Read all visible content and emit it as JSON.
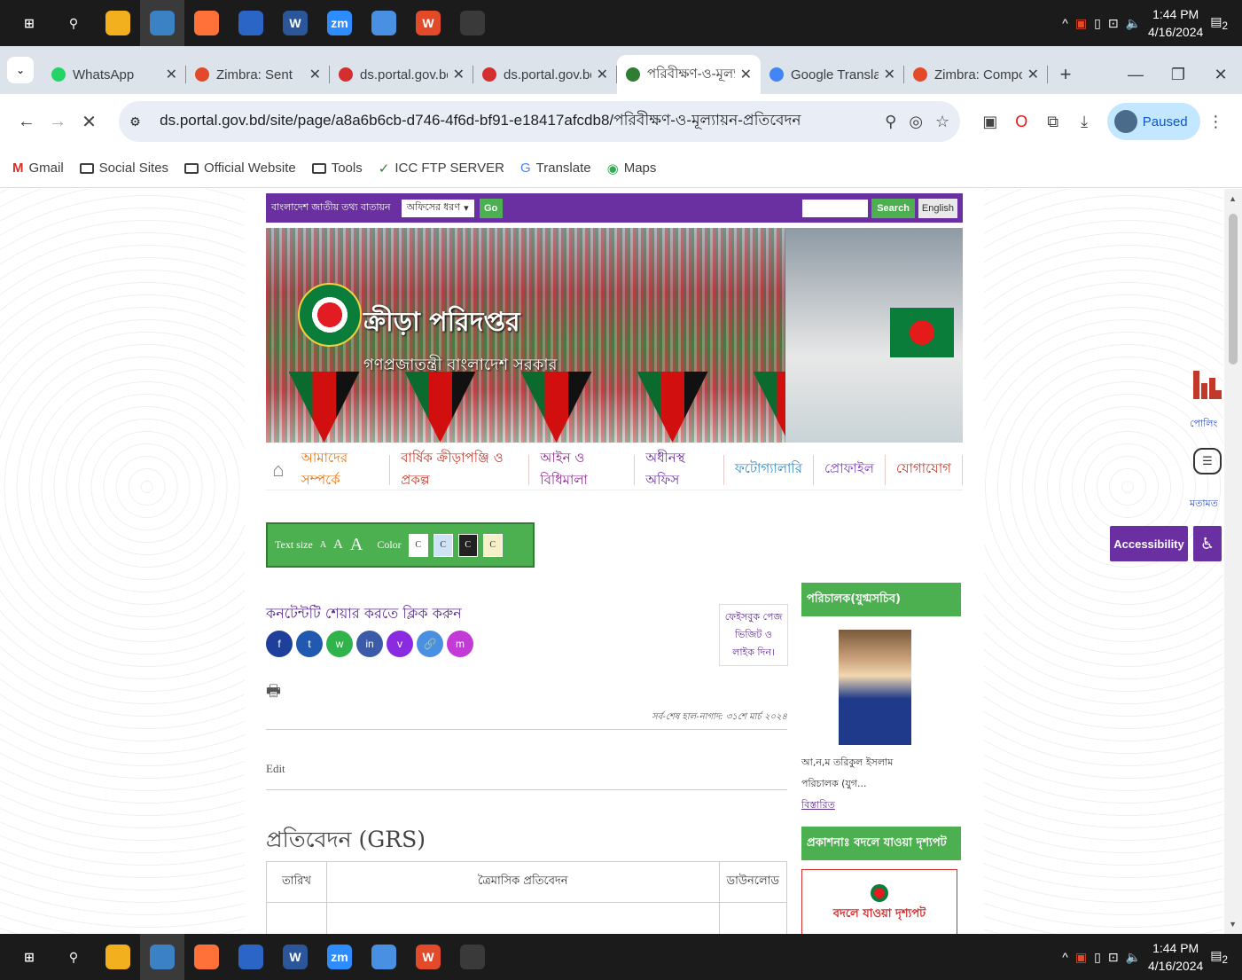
{
  "taskbar": {
    "apps": [
      {
        "name": "start",
        "glyph": "⊞",
        "color": "#1b1b1b"
      },
      {
        "name": "search",
        "glyph": "⚲",
        "color": "#1b1b1b"
      },
      {
        "name": "file-explorer",
        "glyph": "",
        "color": "#f2b01e"
      },
      {
        "name": "chrome",
        "glyph": "",
        "color": "#3b82c4"
      },
      {
        "name": "firefox",
        "glyph": "",
        "color": "#ff7139"
      },
      {
        "name": "mail",
        "glyph": "",
        "color": "#2b66c7"
      },
      {
        "name": "word",
        "glyph": "W",
        "color": "#2b579a"
      },
      {
        "name": "zoom",
        "glyph": "zm",
        "color": "#2d8cff"
      },
      {
        "name": "phone",
        "glyph": "",
        "color": "#4a90e2"
      },
      {
        "name": "wps",
        "glyph": "W",
        "color": "#e24a2a"
      },
      {
        "name": "app",
        "glyph": "",
        "color": "#3a3a3a"
      }
    ],
    "time": "1:44 PM",
    "date": "4/16/2024",
    "notif": "2"
  },
  "tabs": [
    {
      "title": "WhatsApp",
      "color": "#25d366",
      "active": false
    },
    {
      "title": "Zimbra: Sent",
      "color": "#e24a2a",
      "active": false
    },
    {
      "title": "ds.portal.gov.bd",
      "color": "#d32f2f",
      "active": false
    },
    {
      "title": "ds.portal.gov.bd",
      "color": "#d32f2f",
      "active": false
    },
    {
      "title": "পরিবীক্ষণ-ও-মূল্য",
      "color": "#2e7d32",
      "active": true
    },
    {
      "title": "Google Translate",
      "color": "#4285f4",
      "active": false
    },
    {
      "title": "Zimbra: Compose",
      "color": "#e24a2a",
      "active": false
    }
  ],
  "toolbar": {
    "url": "ds.portal.gov.bd/site/page/a8a6b6cb-d746-4f6d-bf91-e18417afcdb8/পরিবীক্ষণ-ও-মূল্যায়ন-প্রতিবেদন",
    "paused": "Paused"
  },
  "bookmarks": [
    {
      "label": "Gmail",
      "type": "gmail"
    },
    {
      "label": "Social Sites",
      "type": "folder"
    },
    {
      "label": "Official Website",
      "type": "folder"
    },
    {
      "label": "Tools",
      "type": "folder"
    },
    {
      "label": "ICC FTP SERVER",
      "type": "link"
    },
    {
      "label": "Translate",
      "type": "translate"
    },
    {
      "label": "Maps",
      "type": "maps"
    }
  ],
  "site": {
    "portal_label": "বাংলাদেশ জাতীয় তথ্য বাতায়ন",
    "office_select": "অফিসের ধরণ",
    "go": "Go",
    "search": "Search",
    "english": "English",
    "title": "ক্রীড়া পরিদপ্তর",
    "subtitle": "গণপ্রজাতন্ত্রী বাংলাদেশ সরকার",
    "nav": [
      {
        "label": "আমাদের সম্পর্কে",
        "color": "#e8730c"
      },
      {
        "label": "বার্ষিক ক্রীড়াপঞ্জি ও প্রকল্প",
        "color": "#c0392b"
      },
      {
        "label": "আইন ও বিধিমালা",
        "color": "#8e2a8e"
      },
      {
        "label": "অধীনস্থ অফিস",
        "color": "#6a2fa0"
      },
      {
        "label": "ফটোগ্যালারি",
        "color": "#2e86c1"
      },
      {
        "label": "প্রোফাইল",
        "color": "#7d3cc2"
      },
      {
        "label": "যোগাযোগ",
        "color": "#c0392b"
      }
    ],
    "accessibility": {
      "text_size": "Text size",
      "a_small": "A",
      "a_mid": "A",
      "a_large": "A",
      "color": "Color",
      "swatches": [
        {
          "label": "C",
          "bg": "#ffffff"
        },
        {
          "label": "C",
          "bg": "#cfe3f7"
        },
        {
          "label": "C",
          "bg": "#222222",
          "fg": "#ffffff"
        },
        {
          "label": "C",
          "bg": "#f6f0c8"
        }
      ]
    },
    "share_title": "কনটেন্টটি শেয়ার করতে ক্লিক করুন",
    "socials": [
      {
        "name": "facebook",
        "glyph": "f",
        "color": "#1e3f9a"
      },
      {
        "name": "twitter",
        "glyph": "t",
        "color": "#2159b0"
      },
      {
        "name": "whatsapp",
        "glyph": "w",
        "color": "#2fb34a"
      },
      {
        "name": "linkedin",
        "glyph": "in",
        "color": "#3b5ba8"
      },
      {
        "name": "viber",
        "glyph": "v",
        "color": "#8a2be2"
      },
      {
        "name": "link",
        "glyph": "🔗",
        "color": "#4a90e2"
      },
      {
        "name": "messenger",
        "glyph": "m",
        "color": "#c23bd6"
      }
    ],
    "fb_like": "ফেইসবুক পেজ ভিজিট ও লাইক দিন।",
    "updated": "সর্ব-শেষ হাল-নাগাদ: ৩১শে মার্চ ২০২৪",
    "edit": "Edit",
    "heading": "প্রতিবেদন (GRS)",
    "table": {
      "headers": [
        "তারিখ",
        "ত্রৈমাসিক প্রতিবেদন",
        "ডাউনলোড"
      ]
    },
    "director": {
      "heading": "পরিচালক(যুগ্মসচিব)",
      "name": "আ,ন,ম তরিকুল ইসলাম",
      "title": "পরিচালক (যুগ...",
      "more": "বিস্তারিত"
    },
    "publication": {
      "heading": "প্রকাশনাঃ বদলে যাওয়া দৃশ্যপট",
      "box_text": "বদলে যাওয়া দৃশ্যপট"
    },
    "widgets": {
      "poll": "পোলিং",
      "feedback": "মতামত",
      "accessibility": "Accessibility"
    }
  }
}
